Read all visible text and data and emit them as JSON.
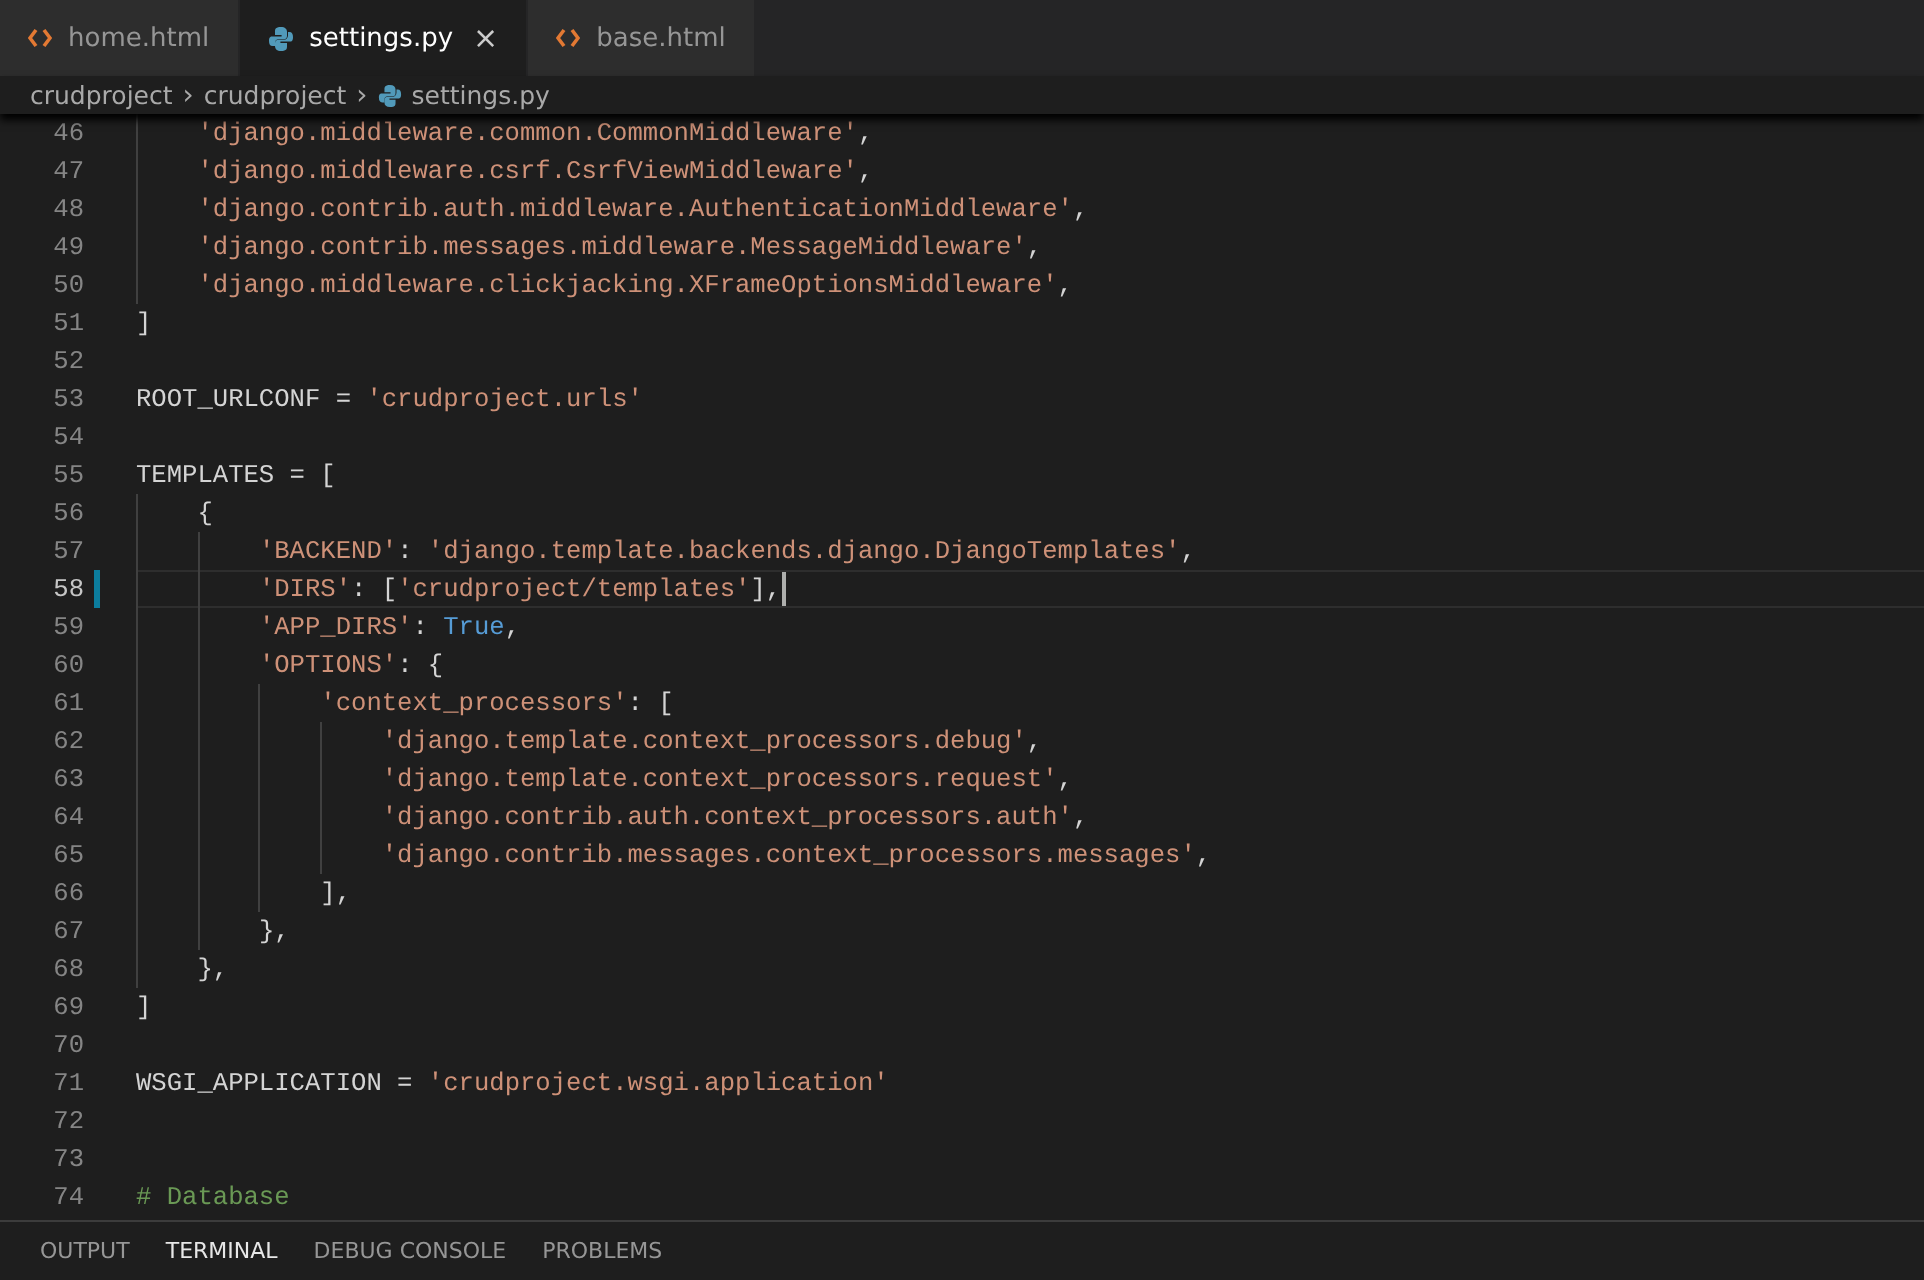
{
  "tabs": [
    {
      "label": "home.html",
      "kind": "html",
      "selected": false
    },
    {
      "label": "settings.py",
      "kind": "python",
      "selected": true,
      "close": "×"
    },
    {
      "label": "base.html",
      "kind": "html",
      "selected": false
    }
  ],
  "breadcrumb": [
    {
      "label": "crudproject",
      "kind": "folder"
    },
    {
      "label": "crudproject",
      "kind": "folder"
    },
    {
      "label": "settings.py",
      "kind": "python"
    }
  ],
  "breadcrumb_separator": "›",
  "lines": [
    {
      "children": [
        {
          "number": "46",
          "current": false,
          "tokens": [
            {
              "kind": "string",
              "text": "'django.middleware.common.CommonMiddleware'"
            },
            {
              "kind": "plain",
              "text": ","
            }
          ]
        },
        {
          "number": "47",
          "current": false,
          "tokens": [
            {
              "kind": "string",
              "text": "'django.middleware.csrf.CsrfViewMiddleware'"
            },
            {
              "kind": "plain",
              "text": ","
            }
          ]
        },
        {
          "number": "48",
          "current": false,
          "tokens": [
            {
              "kind": "string",
              "text": "'django.contrib.auth.middleware.AuthenticationMiddleware'"
            },
            {
              "kind": "plain",
              "text": ","
            }
          ]
        },
        {
          "number": "49",
          "current": false,
          "tokens": [
            {
              "kind": "string",
              "text": "'django.contrib.messages.middleware.MessageMiddleware'"
            },
            {
              "kind": "plain",
              "text": ","
            }
          ]
        },
        {
          "number": "50",
          "current": false,
          "tokens": [
            {
              "kind": "string",
              "text": "'django.middleware.clickjacking.XFrameOptionsMiddleware'"
            },
            {
              "kind": "plain",
              "text": ","
            }
          ]
        }
      ]
    },
    {
      "number": "51",
      "current": false,
      "tokens": [
        {
          "kind": "plain",
          "text": "]"
        }
      ]
    },
    {
      "number": "52",
      "current": false
    },
    {
      "number": "53",
      "current": false,
      "tokens": [
        {
          "kind": "plain",
          "text": "ROOT_URLCONF = "
        },
        {
          "kind": "string",
          "text": "'crudproject.urls'"
        }
      ]
    },
    {
      "number": "54",
      "current": false
    },
    {
      "number": "55",
      "current": false,
      "tokens": [
        {
          "kind": "plain",
          "text": "TEMPLATES = ["
        }
      ],
      "children": [
        {
          "number": "56",
          "current": false,
          "tokens": [
            {
              "kind": "plain",
              "text": "{"
            }
          ],
          "children": [
            {
              "number": "57",
              "current": false,
              "tokens": [
                {
                  "kind": "string",
                  "text": "'BACKEND'"
                },
                {
                  "kind": "plain",
                  "text": ": "
                },
                {
                  "kind": "string",
                  "text": "'django.template.backends.django.DjangoTemplates'"
                },
                {
                  "kind": "plain",
                  "text": ","
                }
              ]
            },
            {
              "number": "58",
              "current": true,
              "tokens": [
                {
                  "kind": "string",
                  "text": "'DIRS'"
                },
                {
                  "kind": "plain",
                  "text": ": ["
                },
                {
                  "kind": "string",
                  "text": "'crudproject/templates'"
                },
                {
                  "kind": "plain",
                  "text": "],"
                }
              ]
            },
            {
              "number": "59",
              "current": false,
              "tokens": [
                {
                  "kind": "string",
                  "text": "'APP_DIRS'"
                },
                {
                  "kind": "plain",
                  "text": ": "
                },
                {
                  "kind": "keyword",
                  "text": "True"
                },
                {
                  "kind": "plain",
                  "text": ","
                }
              ]
            },
            {
              "number": "60",
              "current": false,
              "tokens": [
                {
                  "kind": "string",
                  "text": "'OPTIONS'"
                },
                {
                  "kind": "plain",
                  "text": ": {"
                }
              ],
              "children": [
                {
                  "number": "61",
                  "current": false,
                  "tokens": [
                    {
                      "kind": "string",
                      "text": "'context_processors'"
                    },
                    {
                      "kind": "plain",
                      "text": ": ["
                    }
                  ],
                  "children": [
                    {
                      "number": "62",
                      "current": false,
                      "tokens": [
                        {
                          "kind": "string",
                          "text": "'django.template.context_processors.debug'"
                        },
                        {
                          "kind": "plain",
                          "text": ","
                        }
                      ]
                    },
                    {
                      "number": "63",
                      "current": false,
                      "tokens": [
                        {
                          "kind": "string",
                          "text": "'django.template.context_processors.request'"
                        },
                        {
                          "kind": "plain",
                          "text": ","
                        }
                      ]
                    },
                    {
                      "number": "64",
                      "current": false,
                      "tokens": [
                        {
                          "kind": "string",
                          "text": "'django.contrib.auth.context_processors.auth'"
                        },
                        {
                          "kind": "plain",
                          "text": ","
                        }
                      ]
                    },
                    {
                      "number": "65",
                      "current": false,
                      "tokens": [
                        {
                          "kind": "string",
                          "text": "'django.contrib.messages.context_processors.messages'"
                        },
                        {
                          "kind": "plain",
                          "text": ","
                        }
                      ]
                    }
                  ]
                },
                {
                  "number": "66",
                  "current": false,
                  "tokens": [
                    {
                      "kind": "plain",
                      "text": "],"
                    }
                  ]
                }
              ]
            },
            {
              "number": "67",
              "current": false,
              "tokens": [
                {
                  "kind": "plain",
                  "text": "},"
                }
              ]
            }
          ]
        },
        {
          "number": "68",
          "current": false,
          "tokens": [
            {
              "kind": "plain",
              "text": "},"
            }
          ]
        }
      ]
    },
    {
      "number": "69",
      "current": false,
      "tokens": [
        {
          "kind": "plain",
          "text": "]"
        }
      ]
    },
    {
      "number": "70",
      "current": false
    },
    {
      "number": "71",
      "current": false,
      "tokens": [
        {
          "kind": "plain",
          "text": "WSGI_APPLICATION = "
        },
        {
          "kind": "string",
          "text": "'crudproject.wsgi.application'"
        }
      ]
    },
    {
      "number": "72",
      "current": false
    },
    {
      "number": "73",
      "current": false
    },
    {
      "number": "74",
      "current": false,
      "tokens": [
        {
          "kind": "comment",
          "text": "# Database"
        }
      ]
    }
  ],
  "panel_tabs": [
    {
      "label": "OUTPUT",
      "selected": false
    },
    {
      "label": "TERMINAL",
      "selected": true
    },
    {
      "label": "DEBUG CONSOLE",
      "selected": false
    },
    {
      "label": "PROBLEMS",
      "selected": false
    }
  ]
}
